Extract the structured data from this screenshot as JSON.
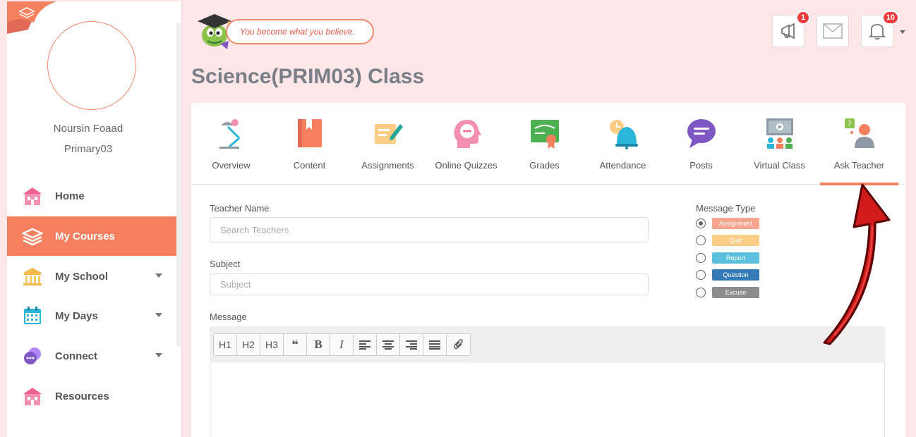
{
  "user": {
    "name": "Noursin Foaad",
    "class": "Primary03"
  },
  "nav": [
    {
      "label": "Home",
      "icon": "school-house-icon",
      "active": false,
      "caret": false
    },
    {
      "label": "My Courses",
      "icon": "layers-icon",
      "active": true,
      "caret": false
    },
    {
      "label": "My School",
      "icon": "bank-building-icon",
      "active": false,
      "caret": true
    },
    {
      "label": "My Days",
      "icon": "calendar-icon",
      "active": false,
      "caret": true
    },
    {
      "label": "Connect",
      "icon": "chat-bubbles-icon",
      "active": false,
      "caret": true
    },
    {
      "label": "Resources",
      "icon": "school-house-icon",
      "active": false,
      "caret": false
    }
  ],
  "quote": "You become what you believe.",
  "badges": {
    "announcements": "1",
    "notifications": "10"
  },
  "page_title": "Science(PRIM03) Class",
  "tabs": [
    {
      "label": "Overview",
      "icon": "desk-lamp-icon"
    },
    {
      "label": "Content",
      "icon": "book-icon"
    },
    {
      "label": "Assignments",
      "icon": "pen-paper-icon"
    },
    {
      "label": "Online Quizzes",
      "icon": "head-chat-icon"
    },
    {
      "label": "Grades",
      "icon": "certificate-icon"
    },
    {
      "label": "Attendance",
      "icon": "clock-bell-icon"
    },
    {
      "label": "Posts",
      "icon": "speech-bubble-icon"
    },
    {
      "label": "Virtual Class",
      "icon": "video-class-icon"
    },
    {
      "label": "Ask Teacher",
      "icon": "question-person-icon",
      "active": true
    }
  ],
  "form": {
    "teacher_label": "Teacher Name",
    "teacher_placeholder": "Search Teachers",
    "subject_label": "Subject",
    "subject_placeholder": "Subject",
    "message_label": "Message",
    "message_type_label": "Message Type",
    "message_types": [
      {
        "label": "Assignment",
        "color": "#f9a48e",
        "checked": true
      },
      {
        "label": "Quiz",
        "color": "#fccd85",
        "checked": false
      },
      {
        "label": "Report",
        "color": "#5bc0de",
        "checked": false
      },
      {
        "label": "Question",
        "color": "#337ab7",
        "checked": false
      },
      {
        "label": "Excuse",
        "color": "#8c8c8c",
        "checked": false
      }
    ]
  },
  "toolbar": {
    "h1": "H1",
    "h2": "H2",
    "h3": "H3",
    "quote": "❝",
    "bold": "B",
    "italic": "I"
  },
  "colors": {
    "accent": "#f5805f",
    "background": "#fde6e8",
    "title": "#7a7f87"
  }
}
